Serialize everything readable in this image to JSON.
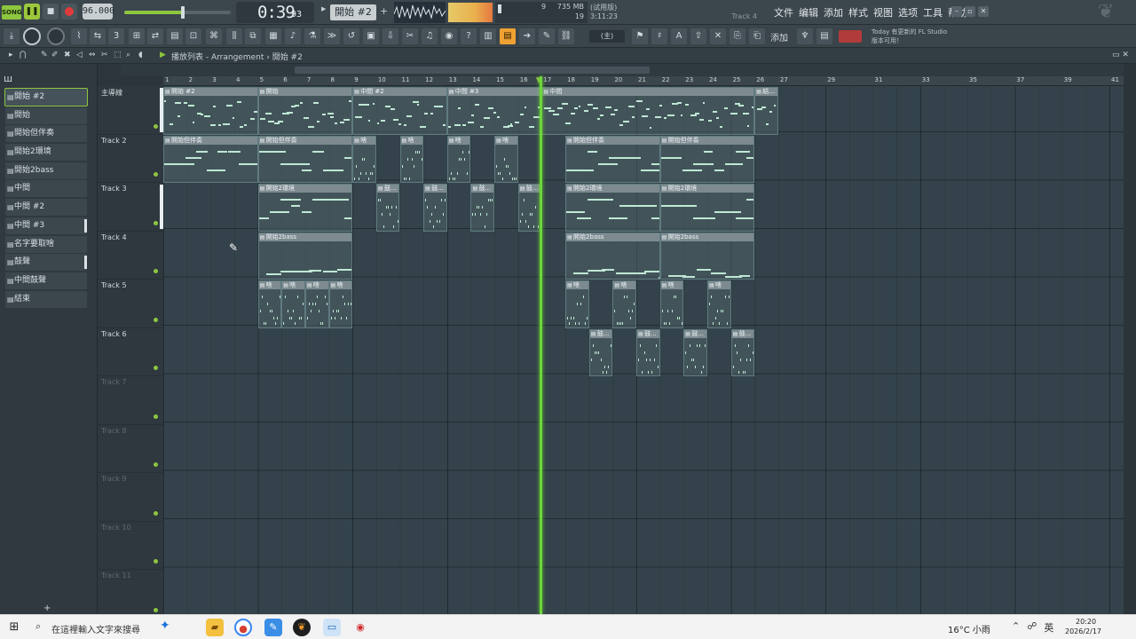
{
  "transport": {
    "mode_label": "SONG",
    "tempo": "96.000",
    "time_main": "0:39",
    "time_frac": "93",
    "pattern": "開始 #2",
    "master_volume": 0.55,
    "cpu_num": "9",
    "memory": "735 MB",
    "polyphony": "19"
  },
  "hint": {
    "line1": "(试用版)",
    "line2": "3:11:23",
    "track": "Track 4"
  },
  "menu": [
    "文件",
    "编辑",
    "添加",
    "样式",
    "视图",
    "选项",
    "工具",
    "帮助"
  ],
  "toolbar": {
    "snap": "(主)",
    "add_label": "添加",
    "news_1": "Today  有更新的 FL Studio",
    "news_2": "版本可用！"
  },
  "panel": {
    "breadcrumb": "播放列表 - Arrangement › 開始 #2"
  },
  "patterns": [
    {
      "label": "開始 #2",
      "selected": true,
      "level": false
    },
    {
      "label": "開始",
      "selected": false,
      "level": false
    },
    {
      "label": "開始但伴奏",
      "selected": false,
      "level": false
    },
    {
      "label": "開始2環境",
      "selected": false,
      "level": false
    },
    {
      "label": "開始2bass",
      "selected": false,
      "level": false
    },
    {
      "label": "中間",
      "selected": false,
      "level": false
    },
    {
      "label": "中間 #2",
      "selected": false,
      "level": false
    },
    {
      "label": "中間 #3",
      "selected": false,
      "level": true
    },
    {
      "label": "名字要取啥",
      "selected": false,
      "level": false
    },
    {
      "label": "鼓聲",
      "selected": false,
      "level": true
    },
    {
      "label": "中間鼓聲",
      "selected": false,
      "level": false
    },
    {
      "label": "結束",
      "selected": false,
      "level": false
    }
  ],
  "tracks": [
    {
      "label": "主導線",
      "active": true,
      "level": true
    },
    {
      "label": "Track 2",
      "active": true,
      "level": false
    },
    {
      "label": "Track 3",
      "active": true,
      "level": true
    },
    {
      "label": "Track 4",
      "active": true,
      "level": false
    },
    {
      "label": "Track 5",
      "active": true,
      "level": false
    },
    {
      "label": "Track 6",
      "active": true,
      "level": false
    },
    {
      "label": "Track 7",
      "active": false,
      "level": false
    },
    {
      "label": "Track 8",
      "active": false,
      "level": false
    },
    {
      "label": "Track 9",
      "active": false,
      "level": false
    },
    {
      "label": "Track 10",
      "active": false,
      "level": false
    },
    {
      "label": "Track 11",
      "active": false,
      "level": false
    }
  ],
  "bars": [
    "1",
    "2",
    "3",
    "4",
    "5",
    "6",
    "7",
    "8",
    "9",
    "10",
    "11",
    "12",
    "13",
    "14",
    "15",
    "16",
    "17",
    "18",
    "19",
    "20",
    "21",
    "22",
    "23",
    "24",
    "25",
    "26",
    "27",
    "29",
    "31",
    "33",
    "35",
    "37",
    "39",
    "41"
  ],
  "clips": [
    {
      "track": 0,
      "bar": 1,
      "len": 4,
      "name": "開始 #2",
      "style": "melody"
    },
    {
      "track": 0,
      "bar": 5,
      "len": 4,
      "name": "開始",
      "style": "melody"
    },
    {
      "track": 0,
      "bar": 9,
      "len": 4,
      "name": "中間 #2",
      "style": "melody"
    },
    {
      "track": 0,
      "bar": 13,
      "len": 4,
      "name": "中間 #3",
      "style": "melody"
    },
    {
      "track": 0,
      "bar": 17,
      "len": 9,
      "name": "中間",
      "style": "melody"
    },
    {
      "track": 0,
      "bar": 26,
      "len": 1,
      "name": "結...",
      "style": "melody"
    },
    {
      "track": 1,
      "bar": 1,
      "len": 4,
      "name": "開始但伴奏",
      "style": "pad"
    },
    {
      "track": 1,
      "bar": 5,
      "len": 4,
      "name": "開始但伴奏",
      "style": "pad"
    },
    {
      "track": 1,
      "bar": 9,
      "len": 1,
      "name": "啥",
      "style": "drum"
    },
    {
      "track": 1,
      "bar": 11,
      "len": 1,
      "name": "啥",
      "style": "drum"
    },
    {
      "track": 1,
      "bar": 13,
      "len": 1,
      "name": "啥",
      "style": "drum"
    },
    {
      "track": 1,
      "bar": 15,
      "len": 1,
      "name": "啥",
      "style": "drum"
    },
    {
      "track": 1,
      "bar": 18,
      "len": 4,
      "name": "開始但伴奏",
      "style": "pad"
    },
    {
      "track": 1,
      "bar": 22,
      "len": 4,
      "name": "開始但伴奏",
      "style": "pad"
    },
    {
      "track": 2,
      "bar": 5,
      "len": 4,
      "name": "開始2環境",
      "style": "pad"
    },
    {
      "track": 2,
      "bar": 10,
      "len": 1,
      "name": "鼓...",
      "style": "drum"
    },
    {
      "track": 2,
      "bar": 12,
      "len": 1,
      "name": "鼓...",
      "style": "drum"
    },
    {
      "track": 2,
      "bar": 14,
      "len": 1,
      "name": "鼓...",
      "style": "drum"
    },
    {
      "track": 2,
      "bar": 16,
      "len": 1,
      "name": "鼓...",
      "style": "drum"
    },
    {
      "track": 2,
      "bar": 18,
      "len": 4,
      "name": "開始2環境",
      "style": "pad"
    },
    {
      "track": 2,
      "bar": 22,
      "len": 4,
      "name": "開始2環境",
      "style": "pad"
    },
    {
      "track": 3,
      "bar": 5,
      "len": 4,
      "name": "開始2bass",
      "style": "bass"
    },
    {
      "track": 3,
      "bar": 18,
      "len": 4,
      "name": "開始2bass",
      "style": "bass"
    },
    {
      "track": 3,
      "bar": 22,
      "len": 4,
      "name": "開始2bass",
      "style": "bass"
    },
    {
      "track": 4,
      "bar": 5,
      "len": 1,
      "name": "啥",
      "style": "drum"
    },
    {
      "track": 4,
      "bar": 6,
      "len": 1,
      "name": "啥",
      "style": "drum"
    },
    {
      "track": 4,
      "bar": 7,
      "len": 1,
      "name": "啥",
      "style": "drum"
    },
    {
      "track": 4,
      "bar": 8,
      "len": 1,
      "name": "啥",
      "style": "drum"
    },
    {
      "track": 4,
      "bar": 18,
      "len": 1,
      "name": "啥",
      "style": "drum"
    },
    {
      "track": 4,
      "bar": 20,
      "len": 1,
      "name": "啥",
      "style": "drum"
    },
    {
      "track": 4,
      "bar": 22,
      "len": 1,
      "name": "啥",
      "style": "drum"
    },
    {
      "track": 4,
      "bar": 24,
      "len": 1,
      "name": "啥",
      "style": "drum"
    },
    {
      "track": 5,
      "bar": 19,
      "len": 1,
      "name": "鼓...",
      "style": "drum"
    },
    {
      "track": 5,
      "bar": 21,
      "len": 1,
      "name": "鼓...",
      "style": "drum"
    },
    {
      "track": 5,
      "bar": 23,
      "len": 1,
      "name": "鼓...",
      "style": "drum"
    },
    {
      "track": 5,
      "bar": 25,
      "len": 1,
      "name": "鼓...",
      "style": "drum"
    }
  ],
  "playhead_bar": 16.9,
  "taskbar": {
    "search_placeholder": "在這裡輸入文字來搜尋",
    "weather": "16°C  小雨",
    "lang": "英",
    "time": "20:20",
    "date": "2026/2/17"
  },
  "colors": {
    "accent": "#8dc63f",
    "playhead": "#6cd63a",
    "clip_header": "#7d8b90",
    "note": "#bfe7d4"
  }
}
